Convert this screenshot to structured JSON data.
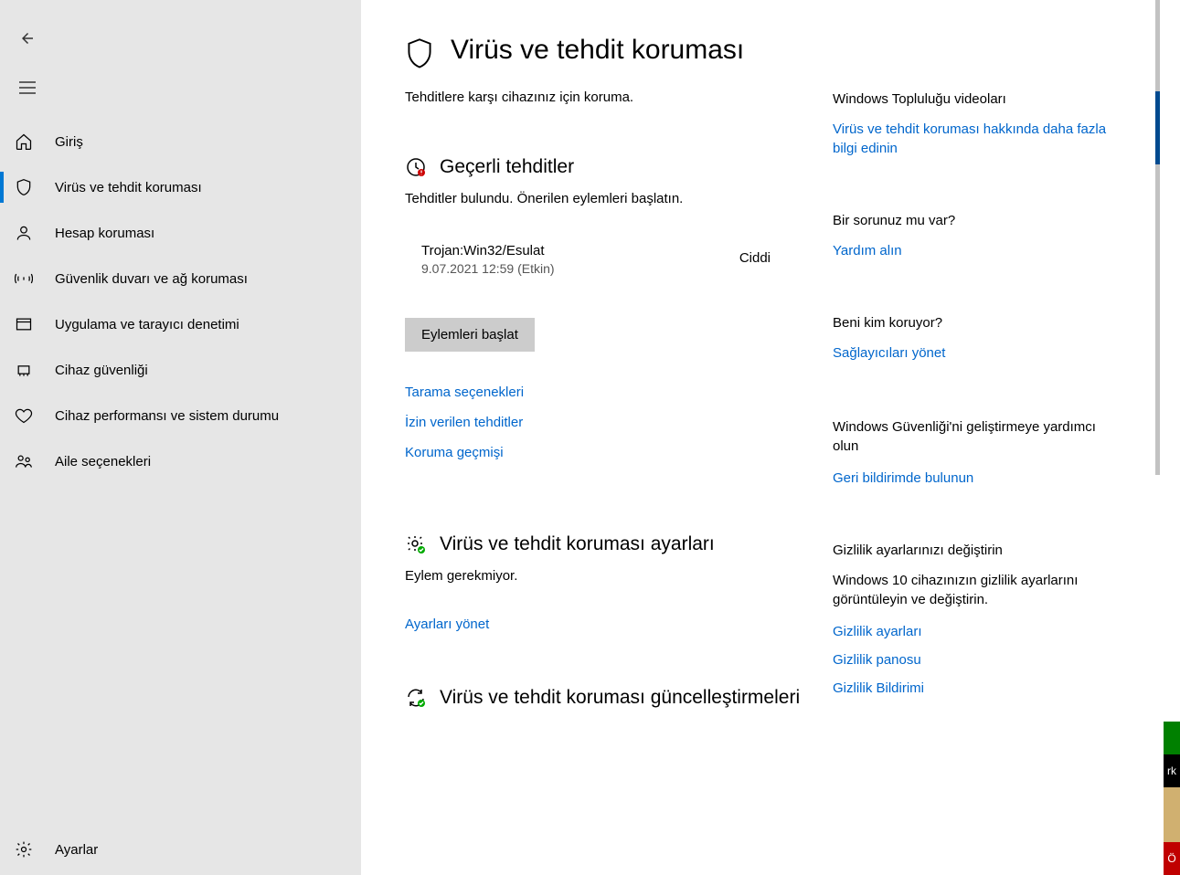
{
  "sidebar": {
    "items": [
      {
        "label": "Giriş"
      },
      {
        "label": "Virüs ve tehdit koruması"
      },
      {
        "label": "Hesap koruması"
      },
      {
        "label": "Güvenlik duvarı ve ağ koruması"
      },
      {
        "label": "Uygulama ve tarayıcı denetimi"
      },
      {
        "label": "Cihaz güvenliği"
      },
      {
        "label": "Cihaz performansı ve sistem durumu"
      },
      {
        "label": "Aile seçenekleri"
      }
    ],
    "settings_label": "Ayarlar"
  },
  "page": {
    "title": "Virüs ve tehdit koruması",
    "subtitle": "Tehditlere karşı cihazınız için koruma."
  },
  "current_threats": {
    "title": "Geçerli tehditler",
    "subtitle": "Tehditler bulundu. Önerilen eylemleri başlatın.",
    "threat": {
      "name": "Trojan:Win32/Esulat",
      "meta": "9.07.2021 12:59 (Etkin)",
      "severity": "Ciddi"
    },
    "action_button": "Eylemleri başlat",
    "links": {
      "scan_options": "Tarama seçenekleri",
      "allowed_threats": "İzin verilen tehditler",
      "protection_history": "Koruma geçmişi"
    }
  },
  "settings_section": {
    "title": "Virüs ve tehdit koruması ayarları",
    "subtitle": "Eylem gerekmiyor.",
    "link": "Ayarları yönet"
  },
  "updates_section": {
    "title": "Virüs ve tehdit koruması güncelleştirmeleri"
  },
  "aside": {
    "community": {
      "title": "Windows Topluluğu videoları",
      "link": "Virüs ve tehdit koruması hakkında daha fazla bilgi edinin"
    },
    "question": {
      "title": "Bir sorunuz mu var?",
      "link": "Yardım alın"
    },
    "protecting": {
      "title": "Beni kim koruyor?",
      "link": "Sağlayıcıları yönet"
    },
    "improve": {
      "title": "Windows Güvenliği'ni geliştirmeye yardımcı olun",
      "link": "Geri bildirimde bulunun"
    },
    "privacy": {
      "title": "Gizlilik ayarlarınızı değiştirin",
      "sub": "Windows 10 cihazınızın gizlilik ayarlarını görüntüleyin ve değiştirin.",
      "link1": "Gizlilik ayarları",
      "link2": "Gizlilik panosu",
      "link3": "Gizlilik Bildirimi"
    }
  },
  "edge": {
    "k": "rk",
    "r": "Ö"
  }
}
